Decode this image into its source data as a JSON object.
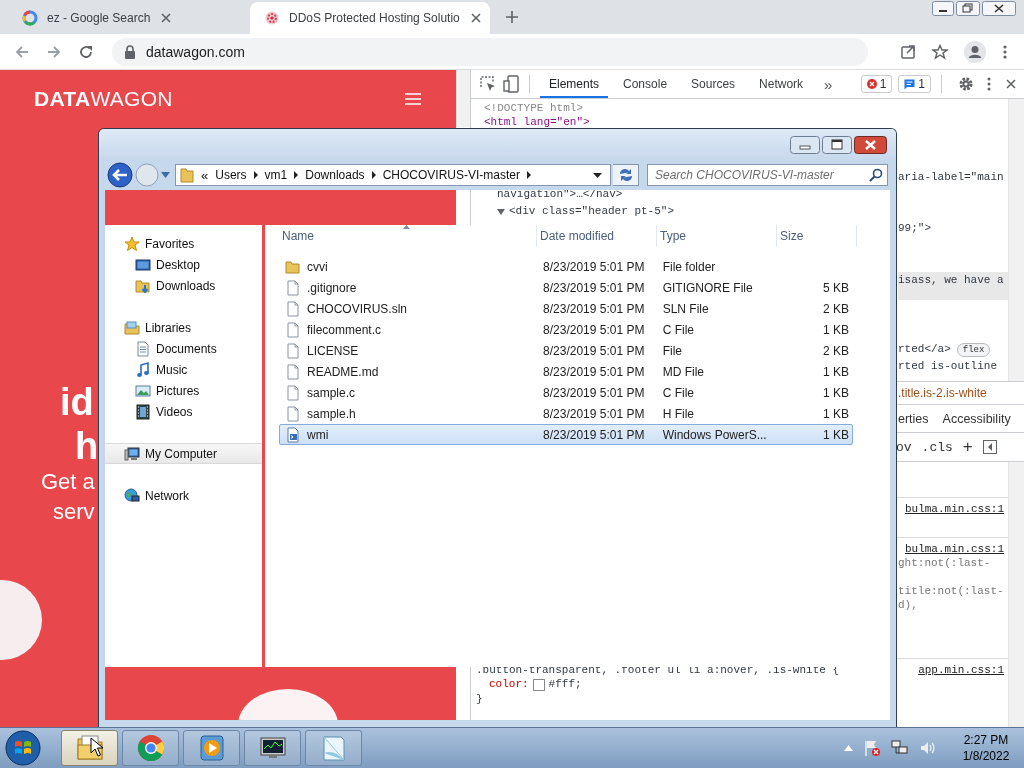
{
  "browser": {
    "tabs": [
      {
        "title": "ez - Google Search",
        "kind": "google",
        "selected": false
      },
      {
        "title": "DDoS Protected Hosting Solutio",
        "kind": "ddos",
        "selected": true
      }
    ],
    "address": "datawagon.com"
  },
  "site": {
    "logo": "**DATA**WAGON",
    "hero_lines": [
      "id",
      "h",
      "Get a",
      "serv"
    ]
  },
  "devtools": {
    "tabs": [
      {
        "label": "Elements",
        "selected": true
      },
      {
        "label": "Console",
        "selected": false
      },
      {
        "label": "Sources",
        "selected": false
      },
      {
        "label": "Network",
        "selected": false
      }
    ],
    "more": "»",
    "errors": "1",
    "messages": "1",
    "dom_lines": [
      {
        "text": "<!DOCTYPE html>",
        "kind": "doctype",
        "selected": false
      },
      {
        "text": "<html lang=\"en\">",
        "kind": "tag",
        "selected": false
      },
      {
        "text": "aria-label=\"main",
        "kind": "clipped",
        "selected": false
      },
      {
        "text": "navigation\">…</nav>",
        "kind": "nested",
        "selected": false
      },
      {
        "text": "<div class=\"header pt-5\">",
        "kind": "nested",
        "selected": false,
        "expanded": true
      },
      {
        "text": "99;\">",
        "kind": "clipped",
        "selected": false
      },
      {
        "text": "isass, we have a",
        "kind": "clipped",
        "selected": true
      },
      {
        "text": "rted</a>",
        "kind": "clipped",
        "selected": false,
        "badge": "flex"
      },
      {
        "text": "rted is-outline",
        "kind": "clipped",
        "selected": false
      }
    ],
    "breadcrumb": ".title.is-2.is-white",
    "pane_tabs": [
      "erties",
      "Accessibility"
    ],
    "filter_buttons": [
      "ov",
      ".cls",
      "+"
    ],
    "rules": [
      {
        "source": "bulma.min.css:1"
      },
      {
        "source": "bulma.min.css:1",
        "lines": [
          {
            "text": "ght:not(:last-",
            "kind": "clipped"
          },
          {
            "text": "title:not(:last-",
            "kind": "clipped"
          },
          {
            "text": "d),",
            "kind": "clipped"
          }
        ]
      },
      {
        "source": "app.min.css:1",
        "lines": [
          {
            "text": ".button-transparent, .footer ul li a:hover, .is-white {",
            "kind": "selector"
          },
          {
            "kind": "declaration",
            "property": "color:",
            "value": "#fff;",
            "color": "#ffffff"
          },
          {
            "text": "}",
            "kind": "close"
          }
        ]
      }
    ]
  },
  "explorer": {
    "overflow": "«",
    "path": [
      "Users",
      "vm1",
      "Downloads",
      "CHOCOVIRUS-VI-master"
    ],
    "search_placeholder": "Search CHOCOVIRUS-VI-master",
    "nav": [
      {
        "label": "Favorites",
        "kind": "favorites",
        "selected": false,
        "children": [
          {
            "label": "Desktop",
            "kind": "desktop",
            "selected": false
          },
          {
            "label": "Downloads",
            "kind": "downloads",
            "selected": false
          }
        ]
      },
      {
        "label": "Libraries",
        "kind": "libraries",
        "selected": false,
        "children": [
          {
            "label": "Documents",
            "kind": "documents",
            "selected": false
          },
          {
            "label": "Music",
            "kind": "music",
            "selected": false
          },
          {
            "label": "Pictures",
            "kind": "pictures",
            "selected": false
          },
          {
            "label": "Videos",
            "kind": "videos",
            "selected": false
          }
        ]
      },
      {
        "label": "My Computer",
        "kind": "computer",
        "selected": true
      },
      {
        "label": "Network",
        "kind": "network",
        "selected": false
      }
    ],
    "columns": [
      "Name",
      "Date modified",
      "Type",
      "Size"
    ],
    "files": [
      {
        "name": "cvvi",
        "date": "8/23/2019 5:01 PM",
        "type": "File folder",
        "kind": "folder",
        "selected": false
      },
      {
        "name": ".gitignore",
        "date": "8/23/2019 5:01 PM",
        "type": "GITIGNORE File",
        "size": "5 KB",
        "kind": "file",
        "selected": false
      },
      {
        "name": "CHOCOVIRUS.sln",
        "date": "8/23/2019 5:01 PM",
        "type": "SLN File",
        "size": "2 KB",
        "kind": "file",
        "selected": false
      },
      {
        "name": "filecomment.c",
        "date": "8/23/2019 5:01 PM",
        "type": "C File",
        "size": "1 KB",
        "kind": "file",
        "selected": false
      },
      {
        "name": "LICENSE",
        "date": "8/23/2019 5:01 PM",
        "type": "File",
        "size": "2 KB",
        "kind": "file",
        "selected": false
      },
      {
        "name": "README.md",
        "date": "8/23/2019 5:01 PM",
        "type": "MD File",
        "size": "1 KB",
        "kind": "file",
        "selected": false
      },
      {
        "name": "sample.c",
        "date": "8/23/2019 5:01 PM",
        "type": "C File",
        "size": "1 KB",
        "kind": "file",
        "selected": false
      },
      {
        "name": "sample.h",
        "date": "8/23/2019 5:01 PM",
        "type": "H File",
        "size": "1 KB",
        "kind": "file",
        "selected": false
      },
      {
        "name": "wmi",
        "date": "8/23/2019 5:01 PM",
        "type": "Windows PowerS...",
        "size": "1 KB",
        "kind": "script",
        "selected": true
      }
    ]
  },
  "taskbar": {
    "apps": [
      {
        "kind": "explorer",
        "active": true
      },
      {
        "kind": "chrome",
        "active": false
      },
      {
        "kind": "media",
        "active": false
      },
      {
        "kind": "monitor",
        "active": false
      },
      {
        "kind": "notepad",
        "active": false
      }
    ],
    "time": "2:27 PM",
    "date": "1/8/2022"
  }
}
